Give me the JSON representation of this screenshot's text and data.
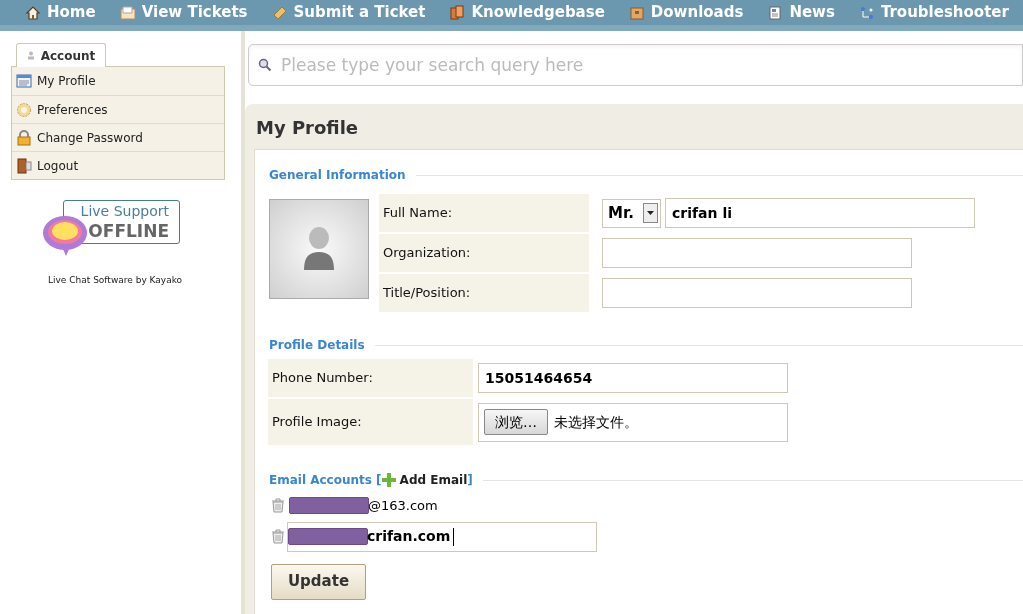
{
  "nav": [
    {
      "kind": "home",
      "label": "Home"
    },
    {
      "kind": "tickets",
      "label": "View Tickets"
    },
    {
      "kind": "submit",
      "label": "Submit a Ticket"
    },
    {
      "kind": "kb",
      "label": "Knowledgebase"
    },
    {
      "kind": "downloads",
      "label": "Downloads"
    },
    {
      "kind": "news",
      "label": "News"
    },
    {
      "kind": "trouble",
      "label": "Troubleshooter"
    }
  ],
  "sidebar": {
    "tab": "Account",
    "items": [
      {
        "kind": "profile",
        "label": "My Profile"
      },
      {
        "kind": "prefs",
        "label": "Preferences"
      },
      {
        "kind": "password",
        "label": "Change Password"
      },
      {
        "kind": "logout",
        "label": "Logout"
      }
    ],
    "live_support": {
      "title": "Live Support",
      "status": "OFFLINE"
    },
    "credit": "Live Chat Software by Kayako"
  },
  "search": {
    "placeholder": "Please type your search query here"
  },
  "profile": {
    "title": "My Profile",
    "general": {
      "heading": "General Information",
      "salutation": "Mr.",
      "fields": [
        {
          "label": "Full Name:",
          "value": "crifan li",
          "kind": "name"
        },
        {
          "label": "Organization:",
          "kind": "text"
        },
        {
          "label": "Title/Position:",
          "kind": "text"
        }
      ]
    },
    "details": {
      "heading": "Profile Details",
      "phone_label": "Phone Number:",
      "phone": "15051464654",
      "image_label": "Profile Image:",
      "browse": "浏览…",
      "no_file": "未选择文件。"
    },
    "emails": {
      "heading": "Email Accounts [",
      "add": "Add Email",
      "close": "]",
      "items": [
        {
          "text": "@163.com",
          "redacted": true,
          "editing": false
        },
        {
          "text": "crifan.com",
          "redacted": true,
          "editing": true
        }
      ]
    },
    "submit": "Update"
  }
}
